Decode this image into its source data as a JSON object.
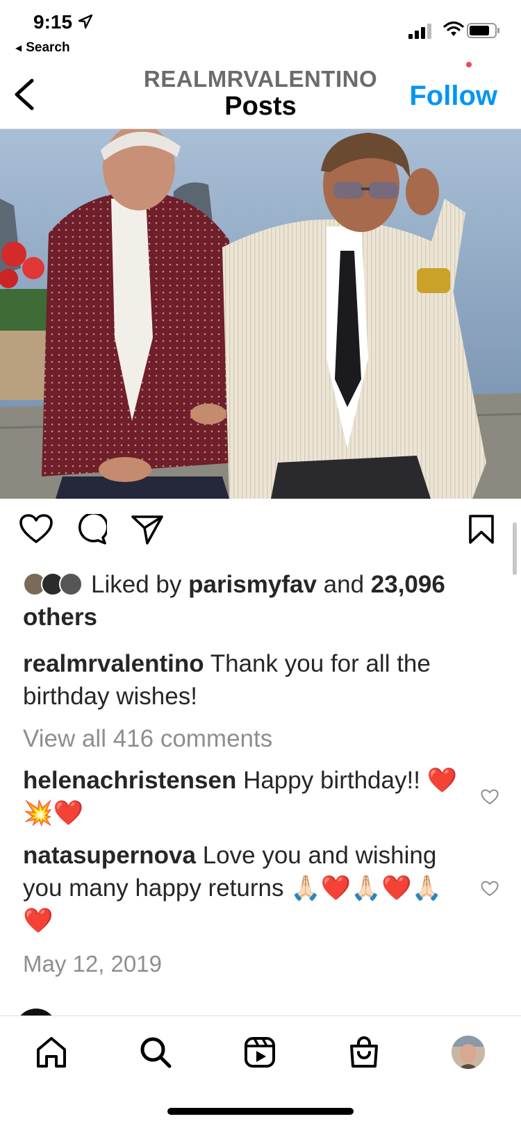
{
  "status_bar": {
    "time": "9:15",
    "back_label": "Search",
    "icons": [
      "location-arrow-icon",
      "cellular-signal-icon",
      "wifi-icon",
      "battery-icon"
    ]
  },
  "header": {
    "username": "REALMRVALENTINO",
    "subtitle": "Posts",
    "follow_label": "Follow",
    "back_icon": "chevron-left-icon"
  },
  "post": {
    "actions": [
      "heart-icon",
      "comment-icon",
      "share-icon",
      "bookmark-icon"
    ],
    "likes": {
      "prefix": "Liked by ",
      "user": "parismyfav",
      "middle": " and ",
      "count": "23,096",
      "suffix": " others"
    },
    "caption": {
      "user": "realmrvalentino",
      "text": " Thank you for all the birthday wishes!"
    },
    "view_all": "View all 416 comments",
    "comments": [
      {
        "user": "helenachristensen",
        "text": " Happy birthday!! ❤️💥❤️"
      },
      {
        "user": "natasupernova",
        "text": " Love you and wishing you many happy returns 🙏🏻❤️🙏🏻❤️🙏🏻❤️"
      }
    ],
    "date": "May 12, 2019"
  },
  "tabbar": {
    "tabs": [
      "home-icon",
      "search-icon",
      "reels-icon",
      "shop-icon",
      "profile-avatar"
    ]
  },
  "colors": {
    "accent": "#0095f6",
    "text": "#262626",
    "muted": "#8e8e8e",
    "notification": "#ed4956"
  }
}
